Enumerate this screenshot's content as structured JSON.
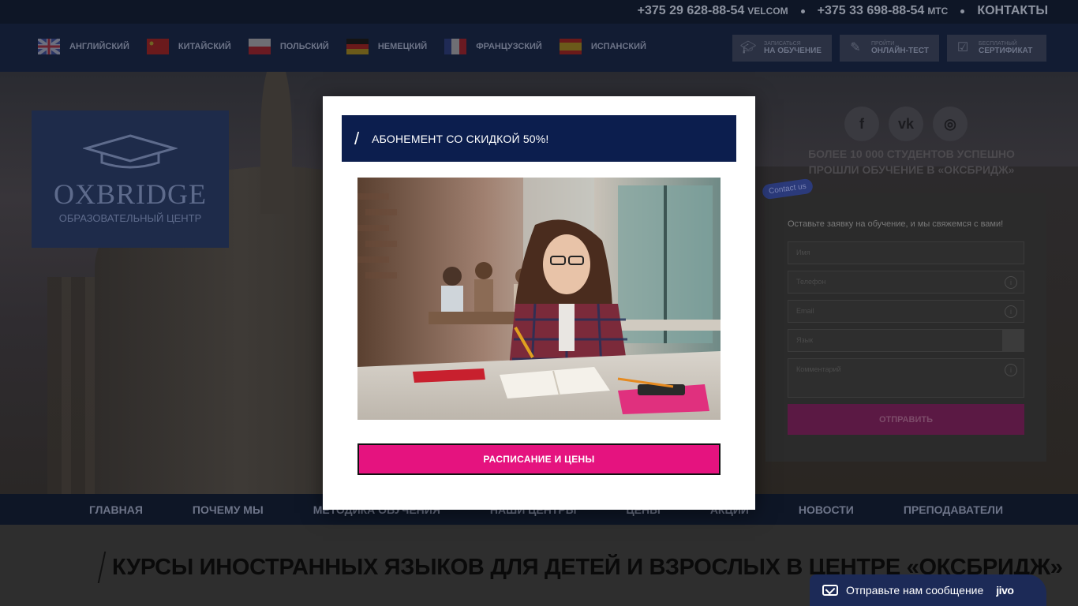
{
  "topbar": {
    "phone1": "+375 29 628-88-54",
    "operator1": "VELCOM",
    "phone2": "+375 33 698-88-54",
    "operator2": "МТС",
    "contacts": "КОНТАКТЫ"
  },
  "languages": [
    {
      "label": "АНГЛИЙСКИЙ",
      "flag": "uk-flag-icon"
    },
    {
      "label": "КИТАЙСКИЙ",
      "flag": "china-flag-icon"
    },
    {
      "label": "ПОЛЬСКИЙ",
      "flag": "poland-flag-icon"
    },
    {
      "label": "НЕМЕЦКИЙ",
      "flag": "germany-flag-icon"
    },
    {
      "label": "ФРАНЦУЗСКИЙ",
      "flag": "france-flag-icon"
    },
    {
      "label": "ИСПАНСКИЙ",
      "flag": "spain-flag-icon"
    }
  ],
  "actions": [
    {
      "small": "записаться",
      "big": "НА ОБУЧЕНИЕ",
      "icon": "graduation-cap-icon"
    },
    {
      "small": "пройти",
      "big": "ОНЛАЙН-ТЕСТ",
      "icon": "pencil-square-icon"
    },
    {
      "small": "бесплатный",
      "big": "СЕРТИФИКАТ",
      "icon": "calendar-check-icon"
    }
  ],
  "logo": {
    "brand": "OXBRIDGE",
    "sub": "ОБРАЗОВАТЕЛЬНЫЙ ЦЕНТР"
  },
  "social": {
    "facebook": "f",
    "vk": "vk",
    "instagram": "◎"
  },
  "students": {
    "line1": "БОЛЕЕ 10 000 СТУДЕНТОВ УСПЕШНО",
    "line2": "ПРОШЛИ ОБУЧЕНИЕ В «ОКСБРИДЖ»"
  },
  "form": {
    "tag": "Contact us",
    "title": "Оставьте заявку на обучение, и мы свяжемся с вами!",
    "name_ph": "Имя",
    "phone_ph": "Телефон",
    "email_ph": "Email",
    "lang_ph": "Язык",
    "comment_ph": "Комментарий",
    "submit": "ОТПРАВИТЬ"
  },
  "nav": [
    "ГЛАВНАЯ",
    "ПОЧЕМУ МЫ",
    "МЕТОДИКА ОБУЧЕНИЯ",
    "НАШИ ЦЕНТРЫ",
    "ЦЕНЫ",
    "АКЦИИ",
    "НОВОСТИ",
    "ПРЕПОДАВАТЕЛИ"
  ],
  "page": {
    "title": "КУРСЫ ИНОСТРАННЫХ ЯЗЫКОВ ДЛЯ ДЕТЕЙ И ВЗРОСЛЫХ В ЦЕНТРЕ «ОКСБРИДЖ»"
  },
  "chat": {
    "message": "Отправьте нам сообщение",
    "brand": "jivo"
  },
  "modal": {
    "close": "×",
    "title": "АБОНЕМЕНТ СО СКИДКОЙ 50%!",
    "button": "РАСПИСАНИЕ И ЦЕНЫ"
  },
  "colors": {
    "navy": "#0c1e4e",
    "pink": "#e5137f",
    "topbar": "#0e1626"
  }
}
